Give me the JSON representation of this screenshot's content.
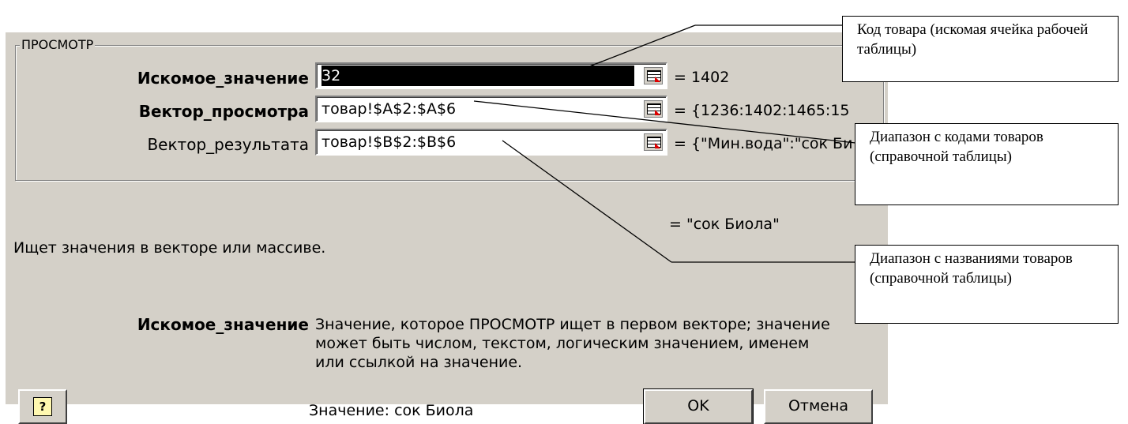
{
  "dialog": {
    "group_title": "ПРОСМОТР",
    "args": [
      {
        "label": "Искомое_значение",
        "value": "32",
        "result": "= 1402"
      },
      {
        "label": "Вектор_просмотра",
        "value": "товар!$A$2:$A$6",
        "result": "= {1236:1402:1465:15"
      },
      {
        "label": "Вектор_результата",
        "value": "товар!$B$2:$B$6",
        "result": "= {\"Мин.вода\":\"сок Би"
      }
    ],
    "final_result": "= \"сок Биола\"",
    "description": "Ищет значения в векторе или массиве.",
    "arg_help_name": "Искомое_значение",
    "arg_help_text": "Значение, которое ПРОСМОТР ищет в первом векторе; значение может быть числом, текстом, логическим значением, именем или ссылкой на значение.",
    "value_line": "Значение: сок Биола",
    "help_icon": "question-mark-icon",
    "ok_label": "OK",
    "cancel_label": "Отмена"
  },
  "callouts": {
    "product_code": "Код товара (искомая ячейка рабочей таблицы)",
    "code_range": "Диапазон с кодами товаров (справочной таблицы)",
    "name_range": "Диапазон с названиями товаров (справочной таблицы)"
  },
  "colors": {
    "dialog_bg": "#d4d0c8",
    "selection": "#000000",
    "ref_arrow": "#e00000"
  }
}
